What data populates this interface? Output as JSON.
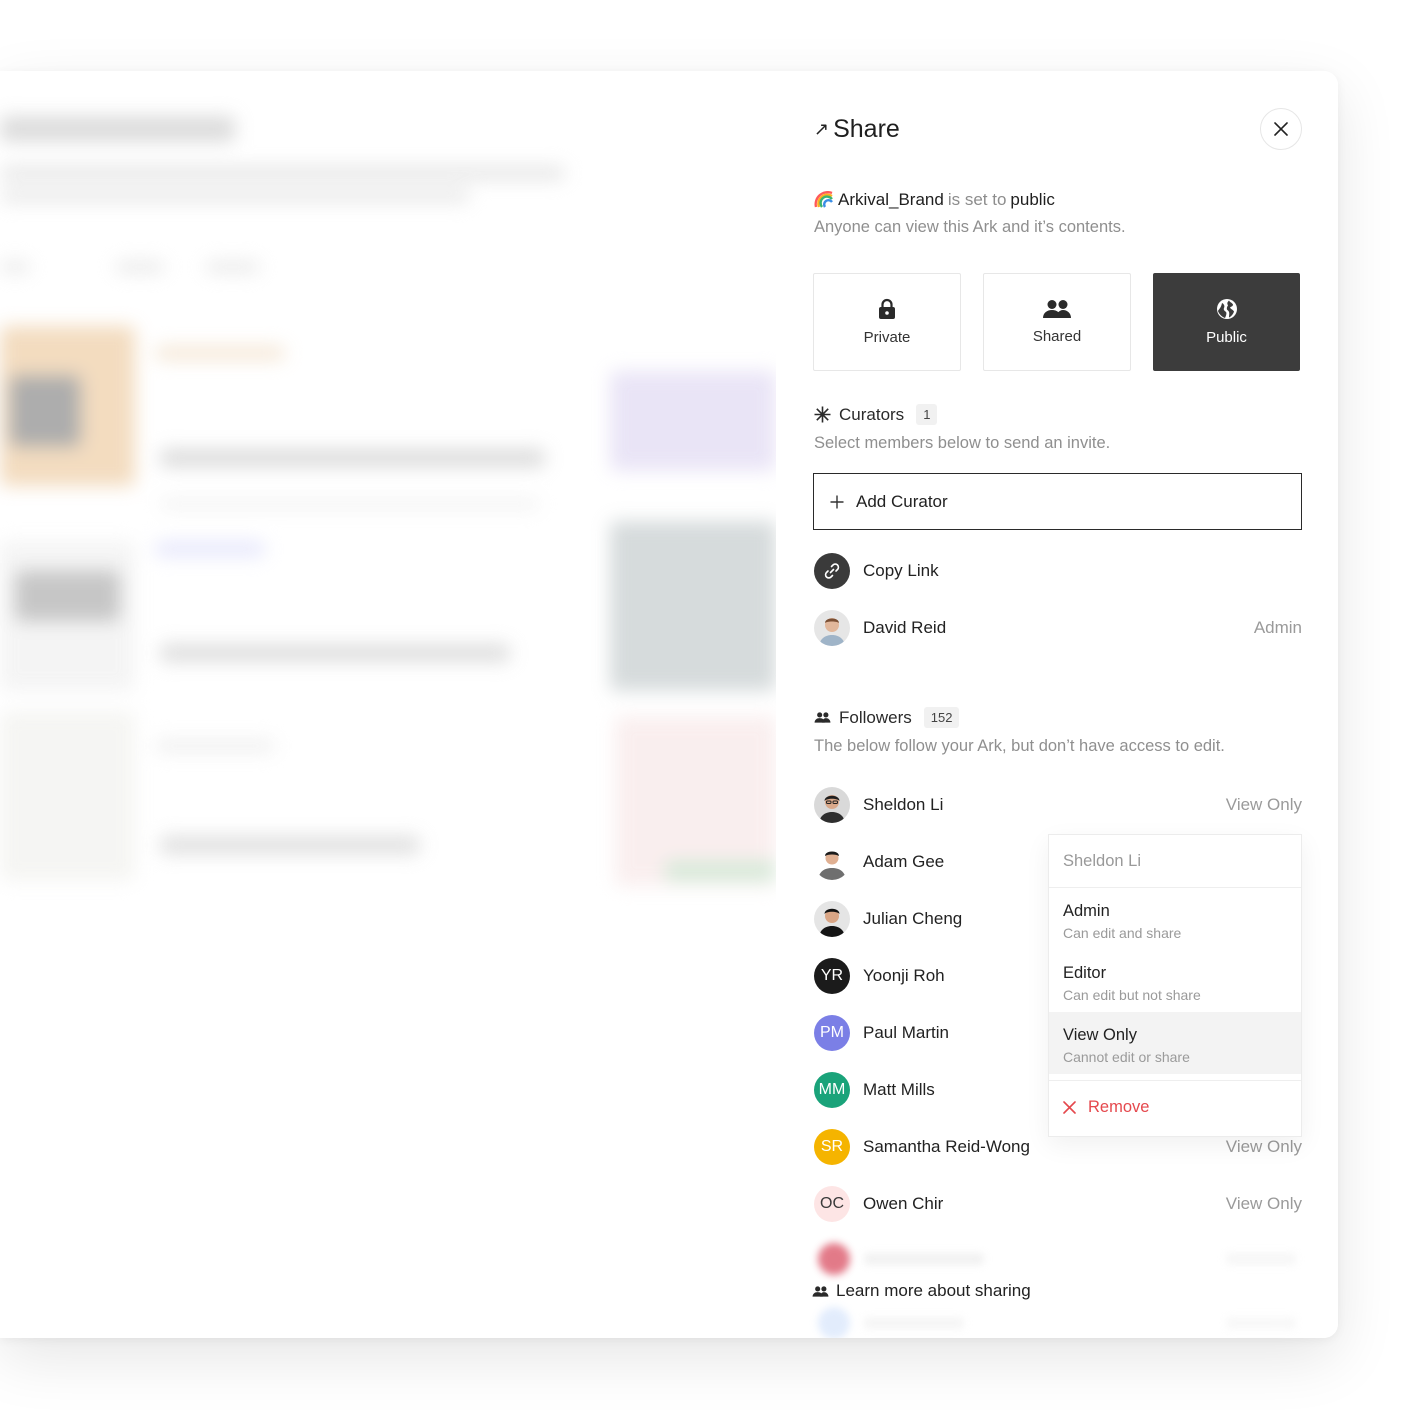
{
  "panel": {
    "title": "Share",
    "ark_name": "Arkival_Brand",
    "status_mid": "is set to",
    "status_value": "public",
    "status_desc": "Anyone can view this Ark and it’s contents."
  },
  "visibility": [
    {
      "label": "Private",
      "icon": "lock-icon"
    },
    {
      "label": "Shared",
      "icon": "people-icon"
    },
    {
      "label": "Public",
      "icon": "globe-icon",
      "active": true
    }
  ],
  "curators": {
    "title": "Curators",
    "count": "1",
    "desc": "Select members below to send an invite.",
    "add_label": "Add Curator",
    "copy_link": "Copy Link",
    "members": [
      {
        "name": "David Reid",
        "role": "Admin"
      }
    ]
  },
  "followers": {
    "title": "Followers",
    "count": "152",
    "desc": "The below follow your Ark, but don’t have access to edit.",
    "list": [
      {
        "name": "Sheldon Li",
        "role": "View Only",
        "initials": "",
        "color": "#444444"
      },
      {
        "name": "Adam Gee",
        "role": "",
        "initials": "",
        "color": "#888888"
      },
      {
        "name": "Julian Cheng",
        "role": "",
        "initials": "",
        "color": "#666666"
      },
      {
        "name": "Yoonji Roh",
        "role": "",
        "initials": "YR",
        "color": "#1b1b1b"
      },
      {
        "name": "Paul Martin",
        "role": "",
        "initials": "PM",
        "color": "#7b7fe6"
      },
      {
        "name": "Matt Mills",
        "role": "",
        "initials": "MM",
        "color": "#1aa37a"
      },
      {
        "name": "Samantha Reid-Wong",
        "role": "View Only",
        "initials": "SR",
        "color": "#f5b400"
      },
      {
        "name": "Owen Chir",
        "role": "View Only",
        "initials": "OC",
        "color": "#fde5e5"
      }
    ]
  },
  "menu": {
    "header": "Sheldon Li",
    "options": [
      {
        "title": "Admin",
        "sub": "Can edit and share"
      },
      {
        "title": "Editor",
        "sub": "Can edit but not share"
      },
      {
        "title": "View Only",
        "sub": "Cannot edit or share",
        "selected": true
      }
    ],
    "remove": "Remove"
  },
  "footer": {
    "learn_more": "Learn more about sharing"
  }
}
